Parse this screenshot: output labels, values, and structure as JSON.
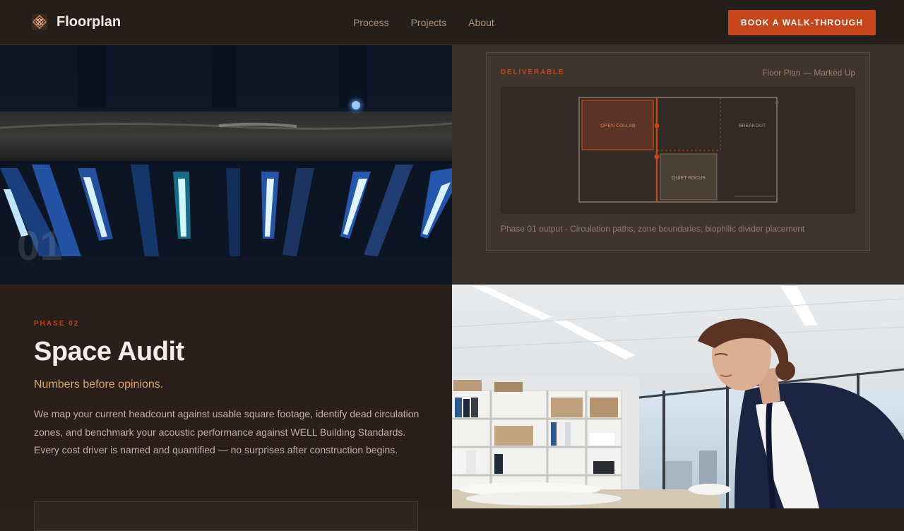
{
  "brand": {
    "name": "Floorplan",
    "icon": "diamond-grid-logo-icon"
  },
  "nav": {
    "links": [
      "Process",
      "Projects",
      "About"
    ],
    "cta_label": "BOOK A WALK-THROUGH"
  },
  "hero": {
    "phase_number": "01"
  },
  "deliverable": {
    "label": "DELIVERABLE",
    "title": "Floor Plan — Marked Up",
    "zones": [
      "OPEN COLLAB",
      "BREAKOUT",
      "QUIET FOCUS"
    ],
    "caption": "Phase 01 output · Circulation paths, zone boundaries, biophilic divider placement"
  },
  "phase2": {
    "label": "PHASE 02",
    "title": "Space Audit",
    "subtitle": "Numbers before opinions.",
    "body": "We map your current headcount against usable square footage, identify dead circulation zones, and benchmark your acoustic performance against WELL Building Standards. Every cost driver is named and quantified — no surprises after construction begins."
  },
  "colors": {
    "accent": "#c4461a",
    "subtitle": "#e0a46a",
    "nav_link": "#b6906e",
    "panel": "#393029"
  }
}
